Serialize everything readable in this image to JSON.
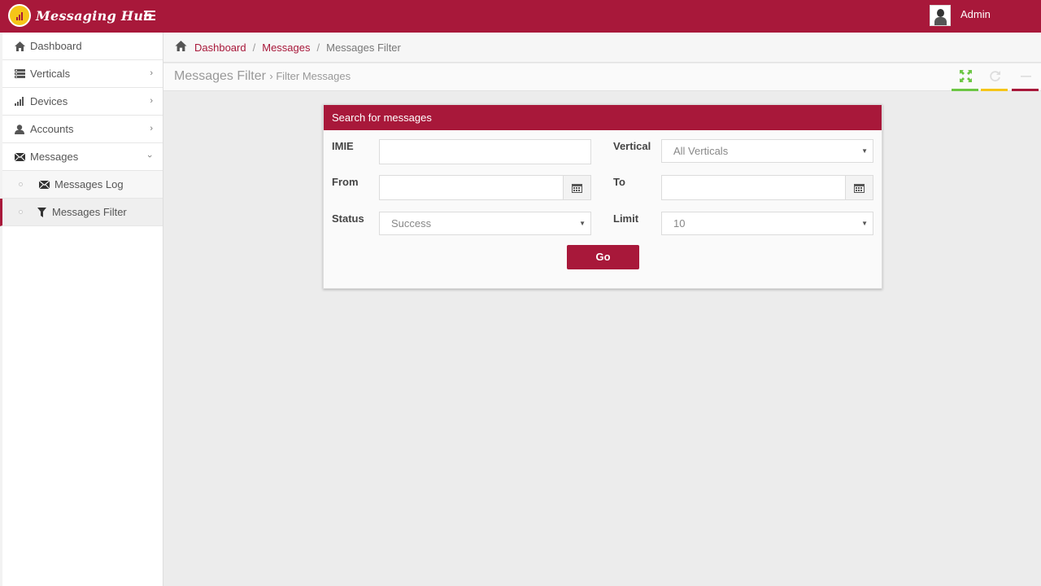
{
  "app": {
    "name": "Messaging Hub"
  },
  "user": {
    "name": "Admin"
  },
  "sidebar": {
    "items": [
      {
        "label": "Dashboard",
        "icon": "home-icon"
      },
      {
        "label": "Verticals",
        "icon": "list-icon"
      },
      {
        "label": "Devices",
        "icon": "signal-icon"
      },
      {
        "label": "Accounts",
        "icon": "user-icon"
      },
      {
        "label": "Messages",
        "icon": "envelope-icon"
      }
    ],
    "subitems": [
      {
        "label": "Messages Log",
        "icon": "envelope-icon"
      },
      {
        "label": "Messages Filter",
        "icon": "filter-icon",
        "active": true
      }
    ]
  },
  "breadcrumb": {
    "items": [
      "Dashboard",
      "Messages",
      "Messages Filter"
    ]
  },
  "page": {
    "title": "Messages Filter",
    "subtitle": "Filter Messages"
  },
  "toolbar": {
    "colors": {
      "fullscreen": "#6cc644",
      "refresh": "#f5c518",
      "collapse": "#a8183a"
    }
  },
  "form": {
    "title": "Search for messages",
    "imie_label": "IMIE",
    "imie_value": "",
    "vertical_label": "Vertical",
    "vertical_value": "All Verticals",
    "from_label": "From",
    "from_value": "",
    "to_label": "To",
    "to_value": "",
    "status_label": "Status",
    "status_value": "Success",
    "limit_label": "Limit",
    "limit_value": "10",
    "submit_label": "Go"
  },
  "theme": {
    "primary": "#a8183a"
  }
}
